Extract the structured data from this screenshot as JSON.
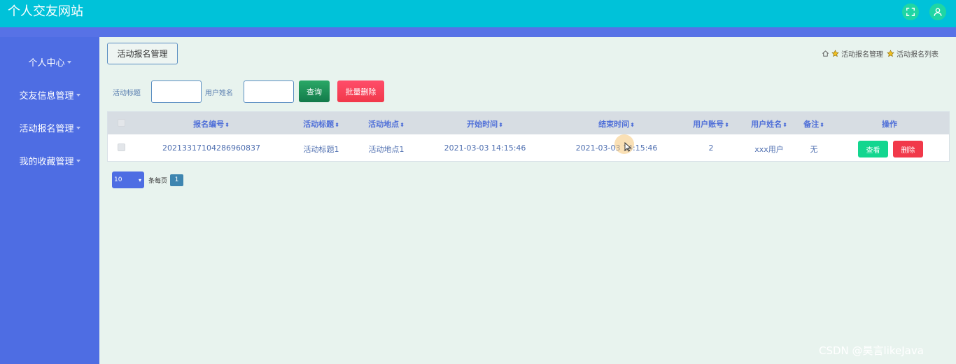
{
  "header": {
    "title": "个人交友网站"
  },
  "sidebar": {
    "items": [
      {
        "label": "个人中心"
      },
      {
        "label": "交友信息管理"
      },
      {
        "label": "活动报名管理"
      },
      {
        "label": "我的收藏管理"
      }
    ]
  },
  "main": {
    "page_title": "活动报名管理",
    "breadcrumb": [
      "活动报名管理",
      "活动报名列表"
    ],
    "search": {
      "title_label": "活动标题",
      "name_label": "用户姓名",
      "title_value": "",
      "name_value": "",
      "query_label": "查询",
      "batch_delete_label": "批量删除"
    },
    "table": {
      "columns": [
        "报名编号",
        "活动标题",
        "活动地点",
        "开始时间",
        "结束时间",
        "用户账号",
        "用户姓名",
        "备注",
        "操作"
      ],
      "rows": [
        {
          "id": "20213317104286960837",
          "title": "活动标题1",
          "location": "活动地点1",
          "start": "2021-03-03 14:15:46",
          "end": "2021-03-03 14:15:46",
          "account": "2",
          "name": "xxx用户",
          "note": "无",
          "view_label": "查看",
          "delete_label": "删除"
        }
      ]
    },
    "pagination": {
      "page_size": "10",
      "per_page_label": "条每页",
      "current_page": "1"
    }
  },
  "watermark": "CSDN @昊言likeJava",
  "colors": {
    "topbar": "#00c2d9",
    "sidebar": "#4e6de3",
    "primary": "#4f6fd8",
    "danger": "#f1394a",
    "success": "#13d68f"
  }
}
